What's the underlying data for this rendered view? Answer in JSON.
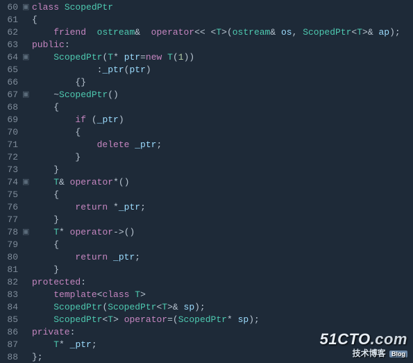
{
  "watermark": {
    "main_a": "51CTO",
    "main_b": ".com",
    "sub": "技术博客",
    "badge": "Blog"
  },
  "lines": [
    {
      "n": 60,
      "fold": "▣",
      "tokens": [
        [
          "kw",
          "class"
        ],
        [
          "punc",
          " "
        ],
        [
          "type",
          "ScopedPtr"
        ]
      ]
    },
    {
      "n": 61,
      "fold": " ",
      "tokens": [
        [
          "brace",
          "{"
        ]
      ]
    },
    {
      "n": 62,
      "fold": " ",
      "tokens": [
        [
          "punc",
          "    "
        ],
        [
          "kw",
          "friend"
        ],
        [
          "punc",
          "  "
        ],
        [
          "type",
          "ostream"
        ],
        [
          "op",
          "&"
        ],
        [
          "punc",
          "  "
        ],
        [
          "kw",
          "operator"
        ],
        [
          "op",
          "<< <"
        ],
        [
          "type",
          "T"
        ],
        [
          "op",
          ">"
        ],
        [
          "punc",
          "("
        ],
        [
          "type",
          "ostream"
        ],
        [
          "op",
          "&"
        ],
        [
          "punc",
          " "
        ],
        [
          "var",
          "os"
        ],
        [
          "punc",
          ", "
        ],
        [
          "type",
          "ScopedPtr"
        ],
        [
          "op",
          "<"
        ],
        [
          "type",
          "T"
        ],
        [
          "op",
          ">&"
        ],
        [
          "punc",
          " "
        ],
        [
          "var",
          "ap"
        ],
        [
          "punc",
          ");"
        ]
      ]
    },
    {
      "n": 63,
      "fold": " ",
      "tokens": [
        [
          "kw",
          "public"
        ],
        [
          "punc",
          ":"
        ]
      ]
    },
    {
      "n": 64,
      "fold": "▣",
      "tokens": [
        [
          "punc",
          "    "
        ],
        [
          "type",
          "ScopedPtr"
        ],
        [
          "punc",
          "("
        ],
        [
          "type",
          "T"
        ],
        [
          "op",
          "*"
        ],
        [
          "punc",
          " "
        ],
        [
          "var",
          "ptr"
        ],
        [
          "op",
          "="
        ],
        [
          "kw",
          "new"
        ],
        [
          "punc",
          " "
        ],
        [
          "type",
          "T"
        ],
        [
          "punc",
          "("
        ],
        [
          "num",
          "1"
        ],
        [
          "punc",
          "))"
        ]
      ]
    },
    {
      "n": 65,
      "fold": " ",
      "tokens": [
        [
          "punc",
          "            "
        ],
        [
          "op",
          ":"
        ],
        [
          "var",
          "_ptr"
        ],
        [
          "punc",
          "("
        ],
        [
          "var",
          "ptr"
        ],
        [
          "punc",
          ")"
        ]
      ]
    },
    {
      "n": 66,
      "fold": " ",
      "tokens": [
        [
          "punc",
          "        "
        ],
        [
          "brace",
          "{}"
        ]
      ]
    },
    {
      "n": 67,
      "fold": "▣",
      "tokens": [
        [
          "punc",
          "    "
        ],
        [
          "op",
          "~"
        ],
        [
          "type",
          "ScopedPtr"
        ],
        [
          "punc",
          "()"
        ]
      ]
    },
    {
      "n": 68,
      "fold": " ",
      "tokens": [
        [
          "punc",
          "    "
        ],
        [
          "brace",
          "{"
        ]
      ]
    },
    {
      "n": 69,
      "fold": " ",
      "tokens": [
        [
          "punc",
          "        "
        ],
        [
          "kw",
          "if"
        ],
        [
          "punc",
          " ("
        ],
        [
          "var",
          "_ptr"
        ],
        [
          "punc",
          ")"
        ]
      ]
    },
    {
      "n": 70,
      "fold": " ",
      "tokens": [
        [
          "punc",
          "        "
        ],
        [
          "brace",
          "{"
        ]
      ]
    },
    {
      "n": 71,
      "fold": " ",
      "tokens": [
        [
          "punc",
          "            "
        ],
        [
          "kw",
          "delete"
        ],
        [
          "punc",
          " "
        ],
        [
          "var",
          "_ptr"
        ],
        [
          "punc",
          ";"
        ]
      ]
    },
    {
      "n": 72,
      "fold": " ",
      "tokens": [
        [
          "punc",
          "        "
        ],
        [
          "brace",
          "}"
        ]
      ]
    },
    {
      "n": 73,
      "fold": " ",
      "tokens": [
        [
          "punc",
          "    "
        ],
        [
          "brace",
          "}"
        ]
      ]
    },
    {
      "n": 74,
      "fold": "▣",
      "tokens": [
        [
          "punc",
          "    "
        ],
        [
          "type",
          "T"
        ],
        [
          "op",
          "&"
        ],
        [
          "punc",
          " "
        ],
        [
          "kw",
          "operator"
        ],
        [
          "op",
          "*"
        ],
        [
          "punc",
          "()"
        ]
      ]
    },
    {
      "n": 75,
      "fold": " ",
      "tokens": [
        [
          "punc",
          "    "
        ],
        [
          "brace",
          "{"
        ]
      ]
    },
    {
      "n": 76,
      "fold": " ",
      "tokens": [
        [
          "punc",
          "        "
        ],
        [
          "kw",
          "return"
        ],
        [
          "punc",
          " "
        ],
        [
          "op",
          "*"
        ],
        [
          "var",
          "_ptr"
        ],
        [
          "punc",
          ";"
        ]
      ]
    },
    {
      "n": 77,
      "fold": " ",
      "tokens": [
        [
          "punc",
          "    "
        ],
        [
          "brace",
          "}"
        ]
      ]
    },
    {
      "n": 78,
      "fold": "▣",
      "tokens": [
        [
          "punc",
          "    "
        ],
        [
          "type",
          "T"
        ],
        [
          "op",
          "*"
        ],
        [
          "punc",
          " "
        ],
        [
          "kw",
          "operator"
        ],
        [
          "op",
          "->"
        ],
        [
          "punc",
          "()"
        ]
      ]
    },
    {
      "n": 79,
      "fold": " ",
      "tokens": [
        [
          "punc",
          "    "
        ],
        [
          "brace",
          "{"
        ]
      ]
    },
    {
      "n": 80,
      "fold": " ",
      "tokens": [
        [
          "punc",
          "        "
        ],
        [
          "kw",
          "return"
        ],
        [
          "punc",
          " "
        ],
        [
          "var",
          "_ptr"
        ],
        [
          "punc",
          ";"
        ]
      ]
    },
    {
      "n": 81,
      "fold": " ",
      "tokens": [
        [
          "punc",
          "    "
        ],
        [
          "brace",
          "}"
        ]
      ]
    },
    {
      "n": 82,
      "fold": " ",
      "tokens": [
        [
          "kw",
          "protected"
        ],
        [
          "punc",
          ":"
        ]
      ]
    },
    {
      "n": 83,
      "fold": " ",
      "tokens": [
        [
          "punc",
          "    "
        ],
        [
          "kw",
          "template"
        ],
        [
          "op",
          "<"
        ],
        [
          "kw",
          "class"
        ],
        [
          "punc",
          " "
        ],
        [
          "type",
          "T"
        ],
        [
          "op",
          ">"
        ]
      ]
    },
    {
      "n": 84,
      "fold": " ",
      "tokens": [
        [
          "punc",
          "    "
        ],
        [
          "type",
          "ScopedPtr"
        ],
        [
          "punc",
          "("
        ],
        [
          "type",
          "ScopedPtr"
        ],
        [
          "op",
          "<"
        ],
        [
          "type",
          "T"
        ],
        [
          "op",
          ">&"
        ],
        [
          "punc",
          " "
        ],
        [
          "var",
          "sp"
        ],
        [
          "punc",
          ");"
        ]
      ]
    },
    {
      "n": 85,
      "fold": " ",
      "tokens": [
        [
          "punc",
          "    "
        ],
        [
          "type",
          "ScopedPtr"
        ],
        [
          "op",
          "<"
        ],
        [
          "type",
          "T"
        ],
        [
          "op",
          ">"
        ],
        [
          "punc",
          " "
        ],
        [
          "kw",
          "operator"
        ],
        [
          "op",
          "="
        ],
        [
          "punc",
          "("
        ],
        [
          "type",
          "ScopedPtr"
        ],
        [
          "op",
          "*"
        ],
        [
          "punc",
          " "
        ],
        [
          "var",
          "sp"
        ],
        [
          "punc",
          ");"
        ]
      ]
    },
    {
      "n": 86,
      "fold": " ",
      "tokens": [
        [
          "kw",
          "private"
        ],
        [
          "punc",
          ":"
        ]
      ]
    },
    {
      "n": 87,
      "fold": " ",
      "tokens": [
        [
          "punc",
          "    "
        ],
        [
          "type",
          "T"
        ],
        [
          "op",
          "*"
        ],
        [
          "punc",
          " "
        ],
        [
          "var",
          "_ptr"
        ],
        [
          "punc",
          ";"
        ]
      ]
    },
    {
      "n": 88,
      "fold": " ",
      "tokens": [
        [
          "brace",
          "};"
        ]
      ]
    }
  ]
}
